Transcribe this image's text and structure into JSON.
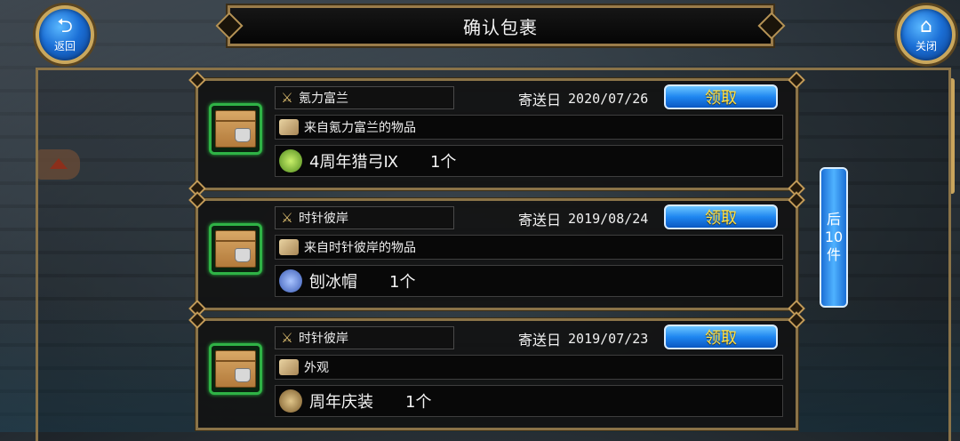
{
  "header": {
    "title": "确认包裹",
    "back_label": "返回",
    "close_label": "关闭"
  },
  "mail": [
    {
      "sender": "氪力富兰",
      "date_label": "寄送日",
      "date": "2020/07/26",
      "claim_label": "领取",
      "subject": "来自氪力富兰的物品",
      "item_name": "4周年猎弓Ⅸ",
      "item_qty": "1个",
      "item_icon": "bow-icon",
      "item_icon_color": "#8fcf3a"
    },
    {
      "sender": "时针彼岸",
      "date_label": "寄送日",
      "date": "2019/08/24",
      "claim_label": "领取",
      "subject": "来自时针彼岸的物品",
      "item_name": "刨冰帽",
      "item_qty": "1个",
      "item_icon": "ice-hat-icon",
      "item_icon_color": "#6f8fd8"
    },
    {
      "sender": "时针彼岸",
      "date_label": "寄送日",
      "date": "2019/07/23",
      "claim_label": "领取",
      "subject": "外观",
      "item_name": "周年庆装",
      "item_qty": "1个",
      "item_icon": "costume-icon",
      "item_icon_color": "#b08a4a"
    }
  ],
  "next_page": {
    "char1": "后",
    "char2": "10",
    "char3": "件"
  },
  "colors": {
    "claim_text": "#ffe24a",
    "frame_gold": "#8a7348",
    "package_border": "#2fb346"
  }
}
